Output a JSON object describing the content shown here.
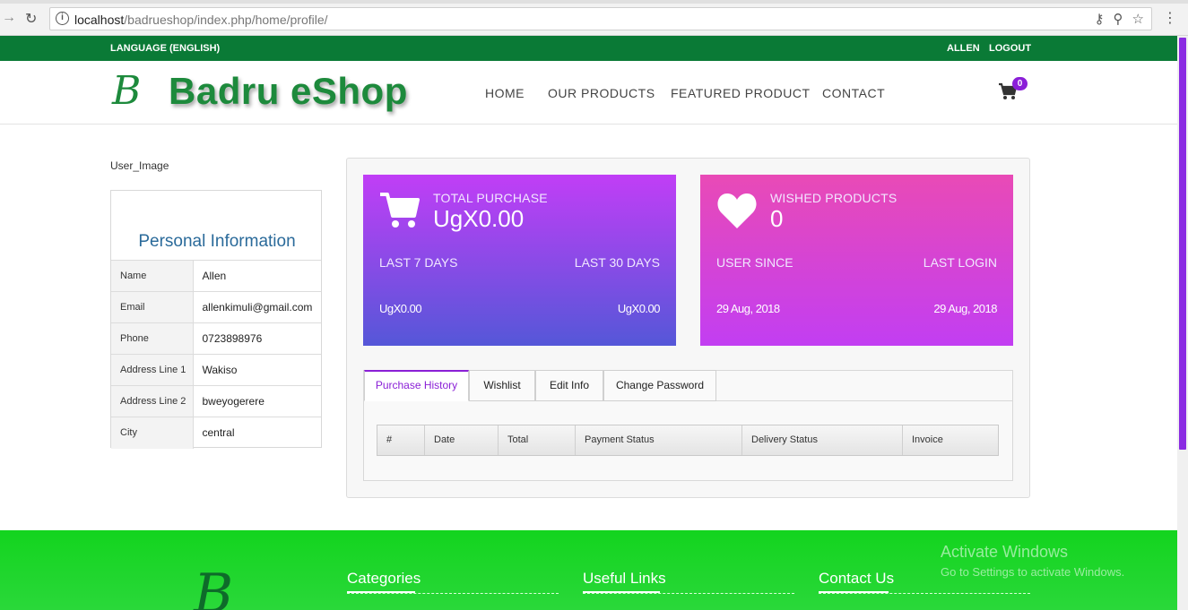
{
  "browser": {
    "url_host": "localhost",
    "url_path": "/badrueshop/index.php/home/profile/"
  },
  "topbar": {
    "language": "LANGUAGE (ENGLISH)",
    "user": "ALLEN",
    "logout": "LOGOUT"
  },
  "header": {
    "logo_letter": "B",
    "logo_text": "Badru eShop",
    "nav": [
      "HOME",
      "OUR PRODUCTS",
      "FEATURED PRODUCT",
      "CONTACT"
    ],
    "cart_count": "0"
  },
  "profile": {
    "image_alt": "User_Image",
    "title": "Personal Information",
    "rows": [
      {
        "key": "Name",
        "value": "Allen"
      },
      {
        "key": "Email",
        "value": "allenkimuli@gmail.com"
      },
      {
        "key": "Phone",
        "value": "0723898976"
      },
      {
        "key": "Address Line 1",
        "value": "Wakiso"
      },
      {
        "key": "Address Line 2",
        "value": "bweyogerere"
      },
      {
        "key": "City",
        "value": "central"
      }
    ]
  },
  "stats": {
    "purchase": {
      "label": "TOTAL PURCHASE",
      "amount": "UgX0.00",
      "left_label": "LAST 7 DAYS",
      "right_label": "LAST 30 DAYS",
      "left_value": "UgX0.00",
      "right_value": "UgX0.00",
      "icon": "cart-icon"
    },
    "wish": {
      "label": "WISHED PRODUCTS",
      "amount": "0",
      "left_label": "USER SINCE",
      "right_label": "LAST LOGIN",
      "left_value": "29 Aug, 2018",
      "right_value": "29 Aug, 2018",
      "icon": "heart-icon"
    }
  },
  "tabs": [
    "Purchase History",
    "Wishlist",
    "Edit Info",
    "Change Password"
  ],
  "orders_columns": [
    "#",
    "Date",
    "Total",
    "Payment Status",
    "Delivery Status",
    "Invoice"
  ],
  "footer": {
    "logo_letter": "B",
    "headings": [
      "Categories",
      "Useful Links",
      "Contact Us"
    ],
    "watermark_title": "Activate Windows",
    "watermark_sub": "Go to Settings to activate Windows."
  },
  "colors": {
    "topbar": "#0a7a36",
    "brand_green": "#1d8a3c",
    "accent_purple": "#8a1fd6",
    "footer_green": "#13d41e"
  }
}
